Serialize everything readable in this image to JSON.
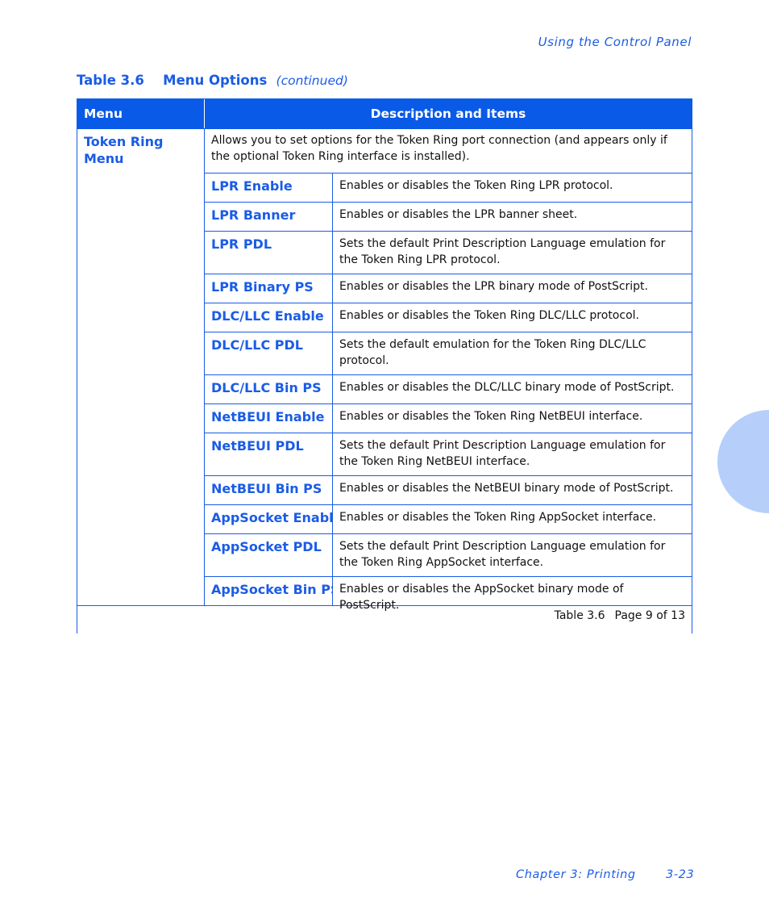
{
  "running_head": "Using the Control Panel",
  "caption": {
    "number": "Table 3.6",
    "title": "Menu Options",
    "continued": "(continued)"
  },
  "table": {
    "headers": [
      "Menu",
      "Description and Items"
    ],
    "menu": "Token Ring Menu",
    "intro": "Allows you to set options for the Token Ring port connection (and appears only if the optional Token Ring interface is installed).",
    "items": [
      {
        "name": "LPR Enable",
        "desc": "Enables or disables the Token Ring LPR protocol."
      },
      {
        "name": "LPR Banner",
        "desc": "Enables or disables the LPR banner sheet."
      },
      {
        "name": "LPR PDL",
        "desc": "Sets the default Print Description Language emulation for the Token Ring LPR protocol."
      },
      {
        "name": "LPR Binary PS",
        "desc": "Enables or disables the LPR binary mode of PostScript."
      },
      {
        "name": "DLC/LLC Enable",
        "desc": "Enables or disables the Token Ring DLC/LLC protocol."
      },
      {
        "name": "DLC/LLC PDL",
        "desc": "Sets the default emulation for the Token Ring DLC/LLC protocol."
      },
      {
        "name": "DLC/LLC Bin PS",
        "desc": "Enables or disables the DLC/LLC binary mode of PostScript."
      },
      {
        "name": "NetBEUI Enable",
        "desc": "Enables or disables the Token Ring NetBEUI interface."
      },
      {
        "name": "NetBEUI PDL",
        "desc": "Sets the default Print Description Language emulation for the Token Ring NetBEUI interface."
      },
      {
        "name": "NetBEUI Bin PS",
        "desc": "Enables or disables the NetBEUI binary mode of PostScript."
      },
      {
        "name": "AppSocket Enabl",
        "desc": "Enables or disables the Token Ring AppSocket interface."
      },
      {
        "name": "AppSocket PDL",
        "desc": "Sets the default Print Description Language emulation for the Token Ring AppSocket interface."
      },
      {
        "name": "AppSocket Bin PS",
        "desc": "Enables or disables the AppSocket binary mode of PostScript."
      }
    ],
    "footer_table": "Table 3.6",
    "footer_page": "Page 9 of 13"
  },
  "footer": {
    "chapter": "Chapter 3: Printing",
    "page": "3-23"
  }
}
